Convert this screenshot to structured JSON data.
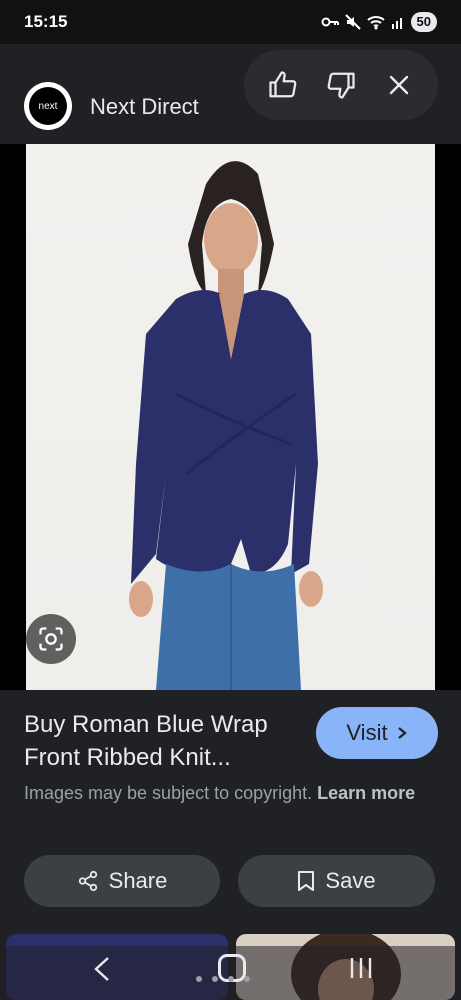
{
  "status_bar": {
    "time": "15:15",
    "battery": "50",
    "icons": [
      "key-icon",
      "mute-icon",
      "wifi-icon",
      "signal-icon"
    ]
  },
  "header": {
    "logo_text": "next",
    "source_name": "Next Direct",
    "feedback": {
      "icons": [
        "thumbs-up-icon",
        "thumbs-down-icon",
        "close-icon"
      ]
    }
  },
  "result": {
    "title": "Buy Roman Blue Wrap Front Ribbed Knit...",
    "visit_label": "Visit",
    "copyright_text": "Images may be subject to copyright.",
    "learn_more": "Learn more"
  },
  "actions": {
    "share_label": "Share",
    "save_label": "Save"
  },
  "colors": {
    "background": "#202124",
    "accent": "#8ab4f8",
    "button": "#3c4043",
    "sweater": "#2b2f6a",
    "jeans": "#3e6fa8"
  }
}
